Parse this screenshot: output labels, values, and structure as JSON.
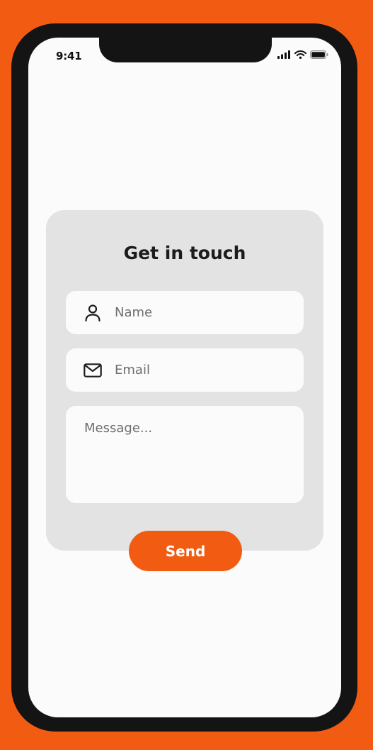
{
  "status_bar": {
    "time": "9:41",
    "icons": [
      "signal-icon",
      "wifi-icon",
      "battery-icon"
    ]
  },
  "form": {
    "title": "Get in touch",
    "name_placeholder": "Name",
    "email_placeholder": "Email",
    "message_placeholder": "Message...",
    "send_label": "Send"
  },
  "colors": {
    "accent": "#F25C12",
    "card_background": "#E3E3E3",
    "screen_background": "#FBFBFB",
    "device_frame": "#141414"
  }
}
